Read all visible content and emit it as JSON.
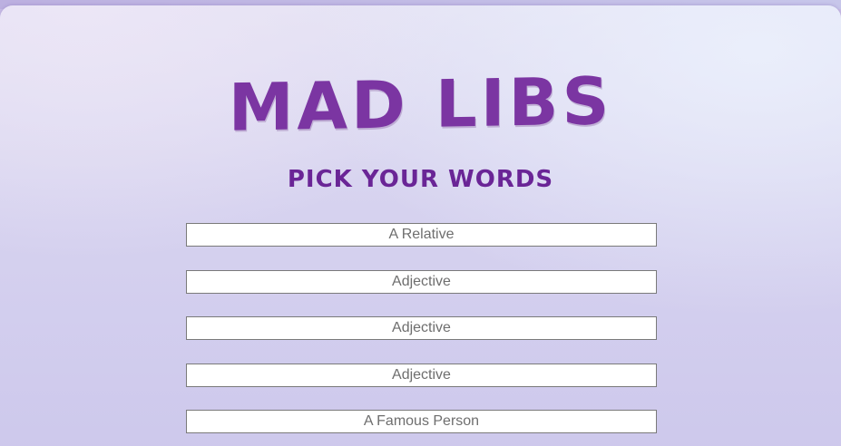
{
  "header": {
    "title": "MAD LIBS",
    "subtitle": "PICK YOUR WORDS"
  },
  "form": {
    "fields": [
      {
        "placeholder": "A Relative",
        "value": ""
      },
      {
        "placeholder": "Adjective",
        "value": ""
      },
      {
        "placeholder": "Adjective",
        "value": ""
      },
      {
        "placeholder": "Adjective",
        "value": ""
      },
      {
        "placeholder": "A Famous Person",
        "value": ""
      }
    ]
  },
  "colors": {
    "title": "#7b35a2",
    "subtitle": "#6a2596",
    "background": "#d6d2ef"
  }
}
